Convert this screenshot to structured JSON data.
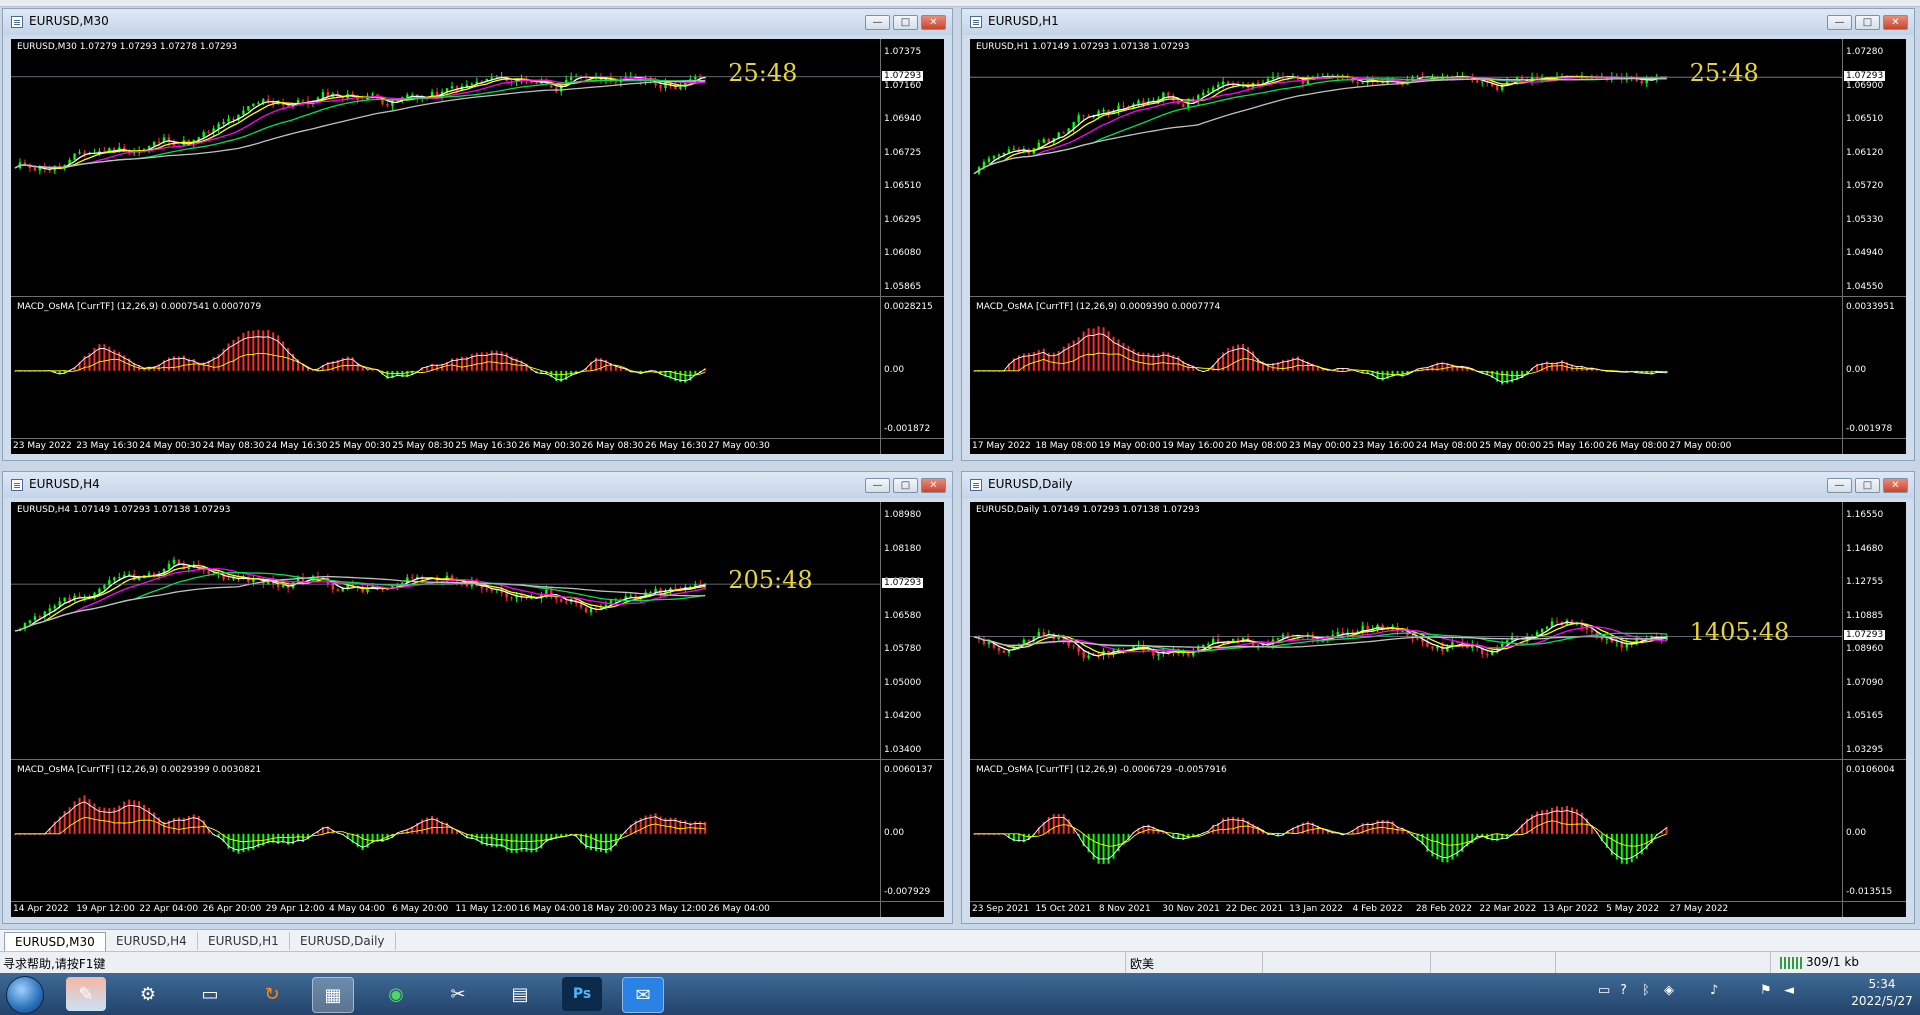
{
  "windows": [
    {
      "title": "EURUSD,M30",
      "info": "EURUSD,M30  1.07279 1.07293 1.07278 1.07293",
      "countdown": "25:48",
      "current_price": "1.07293",
      "price_axis": [
        "1.07375",
        "1.07160",
        "1.06940",
        "1.06725",
        "1.06510",
        "1.06295",
        "1.06080",
        "1.05865"
      ],
      "macd_info": "MACD_OsMA [CurrTF] (12,26,9) 0.0007541 0.0007079",
      "macd_axis": [
        "0.0028215",
        "0.00",
        "-0.001872"
      ],
      "time_axis": [
        "23 May 2022",
        "23 May 16:30",
        "24 May 00:30",
        "24 May 08:30",
        "24 May 16:30",
        "25 May 00:30",
        "25 May 08:30",
        "25 May 16:30",
        "26 May 00:30",
        "26 May 08:30",
        "26 May 16:30",
        "27 May 00:30"
      ],
      "seed": 11
    },
    {
      "title": "EURUSD,H1",
      "info": "EURUSD,H1  1.07149 1.07293 1.07138 1.07293",
      "countdown": "25:48",
      "current_price": "1.07293",
      "price_axis": [
        "1.07280",
        "1.06900",
        "1.06510",
        "1.06120",
        "1.05720",
        "1.05330",
        "1.04940",
        "1.04550"
      ],
      "macd_info": "MACD_OsMA [CurrTF] (12,26,9) 0.0009390 0.0007774",
      "macd_axis": [
        "0.0033951",
        "0.00",
        "-0.001978"
      ],
      "time_axis": [
        "17 May 2022",
        "18 May 08:00",
        "19 May 00:00",
        "19 May 16:00",
        "20 May 08:00",
        "23 May 00:00",
        "23 May 16:00",
        "24 May 08:00",
        "25 May 00:00",
        "25 May 16:00",
        "26 May 08:00",
        "27 May 00:00"
      ],
      "seed": 23
    },
    {
      "title": "EURUSD,H4",
      "info": "EURUSD,H4  1.07149 1.07293 1.07138 1.07293",
      "countdown": "205:48",
      "current_price": "1.07293",
      "price_axis": [
        "1.08980",
        "1.08180",
        "1.07380",
        "1.06580",
        "1.05780",
        "1.05000",
        "1.04200",
        "1.03400"
      ],
      "macd_info": "MACD_OsMA [CurrTF] (12,26,9) 0.0029399 0.0030821",
      "macd_axis": [
        "0.0060137",
        "0.00",
        "-0.007929"
      ],
      "time_axis": [
        "14 Apr 2022",
        "19 Apr 12:00",
        "22 Apr 04:00",
        "26 Apr 20:00",
        "29 Apr 12:00",
        "4 May 04:00",
        "6 May 20:00",
        "11 May 12:00",
        "16 May 04:00",
        "18 May 20:00",
        "23 May 12:00",
        "26 May 04:00"
      ],
      "seed": 37
    },
    {
      "title": "EURUSD,Daily",
      "info": "EURUSD,Daily  1.07149 1.07293 1.07138 1.07293",
      "countdown": "1405:48",
      "current_price": "1.07293",
      "price_axis": [
        "1.16550",
        "1.14680",
        "1.12755",
        "1.10885",
        "1.08960",
        "1.07090",
        "1.05165",
        "1.03295"
      ],
      "macd_info": "MACD_OsMA [CurrTF] (12,26,9) -0.0006729 -0.0057916",
      "macd_axis": [
        "0.0106004",
        "0.00",
        "-0.013515"
      ],
      "time_axis": [
        "23 Sep 2021",
        "15 Oct 2021",
        "8 Nov 2021",
        "30 Nov 2021",
        "22 Dec 2021",
        "13 Jan 2022",
        "4 Feb 2022",
        "28 Feb 2022",
        "22 Mar 2022",
        "13 Apr 2022",
        "5 May 2022",
        "27 May 2022"
      ],
      "seed": 51
    }
  ],
  "tabs": [
    "EURUSD,M30",
    "EURUSD,H4",
    "EURUSD,H1",
    "EURUSD,Daily"
  ],
  "status": {
    "help": "寻求帮助,请按F1键",
    "profile": "欧美",
    "traffic": "309/1 kb"
  },
  "clock": {
    "time": "5:34",
    "date": "2022/5/27"
  },
  "colors": {
    "bull": "#00ff00",
    "bear": "#ff2a2a",
    "ma_fast": "#ffffff",
    "ma_mid": "#ffff00",
    "ma_slow": "#ff00ff",
    "ma_long": "#00e050",
    "ma_200": "#c0c0c0"
  }
}
